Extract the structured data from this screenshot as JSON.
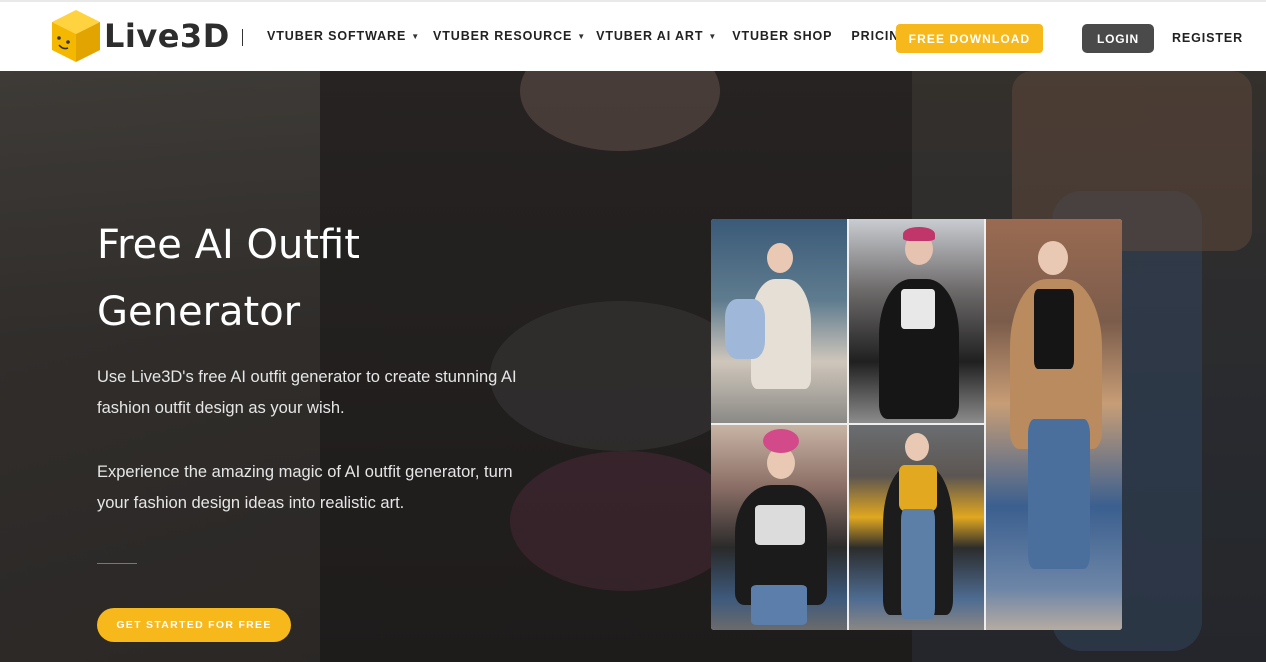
{
  "header": {
    "logo_text": "Live3D",
    "nav": [
      {
        "label": "VTUBER SOFTWARE",
        "dropdown": true
      },
      {
        "label": "VTUBER RESOURCE",
        "dropdown": true
      },
      {
        "label": "VTUBER AI ART",
        "dropdown": true
      },
      {
        "label": "VTUBER SHOP",
        "dropdown": false
      },
      {
        "label": "PRICING",
        "dropdown": false
      }
    ],
    "download_label": "FREE DOWNLOAD",
    "login_label": "LOGIN",
    "register_label": "REGISTER"
  },
  "hero": {
    "title_line1": "Free AI Outfit",
    "title_line2": "Generator",
    "desc1": "Use Live3D's free AI outfit generator to create stunning AI fashion outfit design as your wish.",
    "desc2": "Experience the amazing magic of AI outfit generator, turn your fashion design ideas into realistic art.",
    "cta_label": "GET STARTED FOR FREE"
  },
  "colors": {
    "accent": "#f6b81a",
    "login_bg": "#4a4a4a",
    "nav_text": "#222222"
  },
  "icons": {
    "logo": "yellow-cube-smiley-icon",
    "dropdown": "caret-down-icon"
  }
}
